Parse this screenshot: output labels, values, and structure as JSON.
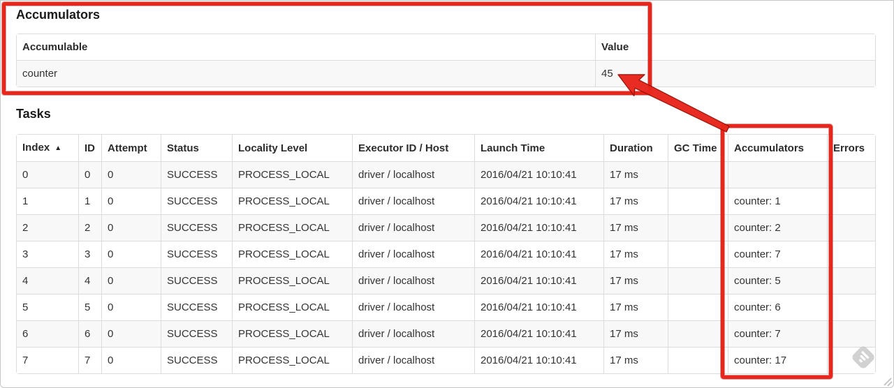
{
  "accumulators_section": {
    "heading": "Accumulators",
    "table": {
      "headers": [
        "Accumulable",
        "Value"
      ],
      "rows": [
        [
          "counter",
          "45"
        ]
      ]
    }
  },
  "tasks_section": {
    "heading": "Tasks",
    "table": {
      "headers": [
        "Index",
        "ID",
        "Attempt",
        "Status",
        "Locality Level",
        "Executor ID / Host",
        "Launch Time",
        "Duration",
        "GC Time",
        "Accumulators",
        "Errors"
      ],
      "sorted_by": "Index",
      "sort_icon": "▲",
      "rows": [
        [
          "0",
          "0",
          "0",
          "SUCCESS",
          "PROCESS_LOCAL",
          "driver / localhost",
          "2016/04/21 10:10:41",
          "17 ms",
          "",
          "",
          ""
        ],
        [
          "1",
          "1",
          "0",
          "SUCCESS",
          "PROCESS_LOCAL",
          "driver / localhost",
          "2016/04/21 10:10:41",
          "17 ms",
          "",
          "counter: 1",
          ""
        ],
        [
          "2",
          "2",
          "0",
          "SUCCESS",
          "PROCESS_LOCAL",
          "driver / localhost",
          "2016/04/21 10:10:41",
          "17 ms",
          "",
          "counter: 2",
          ""
        ],
        [
          "3",
          "3",
          "0",
          "SUCCESS",
          "PROCESS_LOCAL",
          "driver / localhost",
          "2016/04/21 10:10:41",
          "17 ms",
          "",
          "counter: 7",
          ""
        ],
        [
          "4",
          "4",
          "0",
          "SUCCESS",
          "PROCESS_LOCAL",
          "driver / localhost",
          "2016/04/21 10:10:41",
          "17 ms",
          "",
          "counter: 5",
          ""
        ],
        [
          "5",
          "5",
          "0",
          "SUCCESS",
          "PROCESS_LOCAL",
          "driver / localhost",
          "2016/04/21 10:10:41",
          "17 ms",
          "",
          "counter: 6",
          ""
        ],
        [
          "6",
          "6",
          "0",
          "SUCCESS",
          "PROCESS_LOCAL",
          "driver / localhost",
          "2016/04/21 10:10:41",
          "17 ms",
          "",
          "counter: 7",
          ""
        ],
        [
          "7",
          "7",
          "0",
          "SUCCESS",
          "PROCESS_LOCAL",
          "driver / localhost",
          "2016/04/21 10:10:41",
          "17 ms",
          "",
          "counter: 17",
          ""
        ]
      ]
    }
  },
  "annotations": {
    "highlight_color": "#e8261c",
    "box_1_target": "accumulators-summary-section",
    "box_2_target": "tasks-accumulators-column",
    "arrow_target": "accumulator-total-value-45"
  },
  "watermark": {
    "icon": "skitch-feather-icon"
  }
}
